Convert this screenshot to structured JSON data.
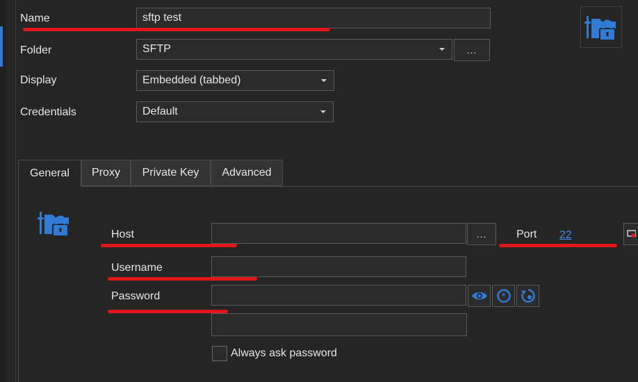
{
  "form": {
    "name_label": "Name",
    "name_value": "sftp test",
    "folder_label": "Folder",
    "folder_value": "SFTP",
    "browse_label": "...",
    "display_label": "Display",
    "display_value": "Embedded (tabbed)",
    "credentials_label": "Credentials",
    "credentials_value": "Default"
  },
  "tabs": [
    {
      "label": "General",
      "active": true
    },
    {
      "label": "Proxy",
      "active": false
    },
    {
      "label": "Private Key",
      "active": false
    },
    {
      "label": "Advanced",
      "active": false
    }
  ],
  "general": {
    "host_label": "Host",
    "host_value": "",
    "host_browse": "...",
    "port_label": "Port",
    "port_value": "22",
    "username_label": "Username",
    "username_value": "",
    "password_label": "Password",
    "password_value": "",
    "always_ask_label": "Always ask password",
    "always_ask_checked": false
  },
  "icons": {
    "header": "sftp-lock-folder-icon",
    "general": "sftp-lock-folder-icon",
    "eye": "eye-icon",
    "generate": "generate-password-icon",
    "reset": "reset-password-icon"
  },
  "colors": {
    "background": "#252525",
    "accent": "#2f7bd6",
    "highlight": "#e0161b"
  }
}
